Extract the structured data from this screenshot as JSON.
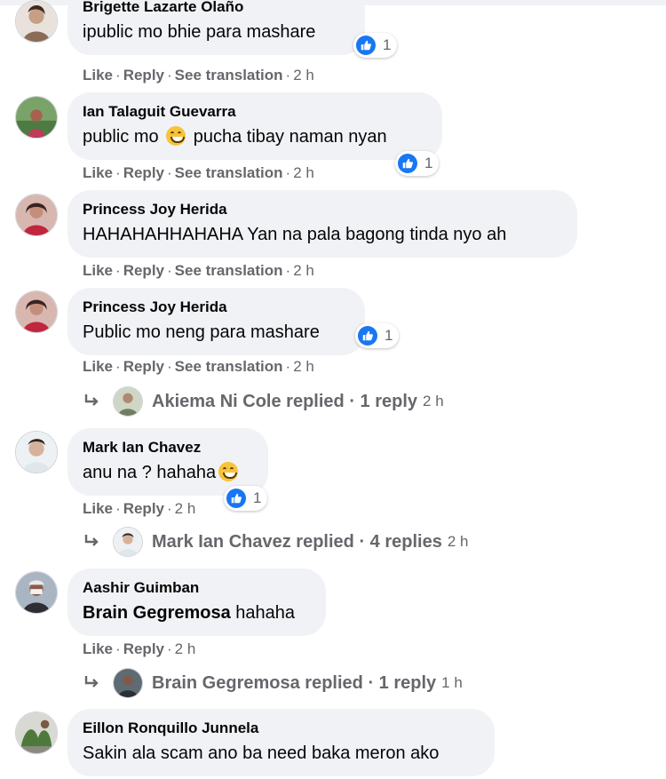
{
  "actions": {
    "like_label": "Like",
    "reply_label": "Reply",
    "translate_label": "See translation",
    "separator": "·"
  },
  "comments": [
    {
      "author": "Brigette Lazarte Olaño",
      "text": "ipublic mo bhie para mashare",
      "reaction_count": "1",
      "time": "2 h",
      "avatar_icon": "user-photo"
    },
    {
      "author": "Ian Talaguit Guevarra",
      "text_before": "public mo",
      "emoji": "grinning-face-emoji",
      "text_after": "pucha tibay naman nyan",
      "reaction_count": "1",
      "time": "2 h",
      "avatar_icon": "user-photo"
    },
    {
      "author": "Princess Joy Herida",
      "text": "HAHAHAHHAHAHA Yan na pala bagong tinda nyo ah",
      "time": "2 h",
      "avatar_icon": "user-photo"
    },
    {
      "author": "Princess Joy Herida",
      "text": "Public mo neng para mashare",
      "reaction_count": "1",
      "time": "2 h",
      "avatar_icon": "user-photo",
      "reply_summary": {
        "replier": "Akiema Ni Cole replied",
        "count": "1 reply",
        "time": "2 h"
      }
    },
    {
      "author": "Mark Ian Chavez",
      "text": "anu na ? hahaha",
      "emoji": "sweat-smile-emoji",
      "reaction_count": "1",
      "time": "2 h",
      "avatar_icon": "user-photo",
      "reply_summary": {
        "replier": "Mark Ian Chavez replied",
        "count": "4 replies",
        "time": "2 h"
      }
    },
    {
      "author": "Aashir Guimban",
      "tag": "Brain Gegremosa",
      "text": "hahaha",
      "time": "2 h",
      "avatar_icon": "user-photo",
      "reply_summary": {
        "replier": "Brain Gegremosa replied",
        "count": "1 reply",
        "time": "1 h"
      }
    },
    {
      "author": "Eillon Ronquillo Junnela",
      "text": "Sakin ala scam ano ba need baka meron ako",
      "avatar_icon": "user-photo"
    }
  ],
  "colors": {
    "bubble": "#f0f2f5",
    "like_blue": "#1877f2",
    "meta_gray": "#65676b"
  }
}
